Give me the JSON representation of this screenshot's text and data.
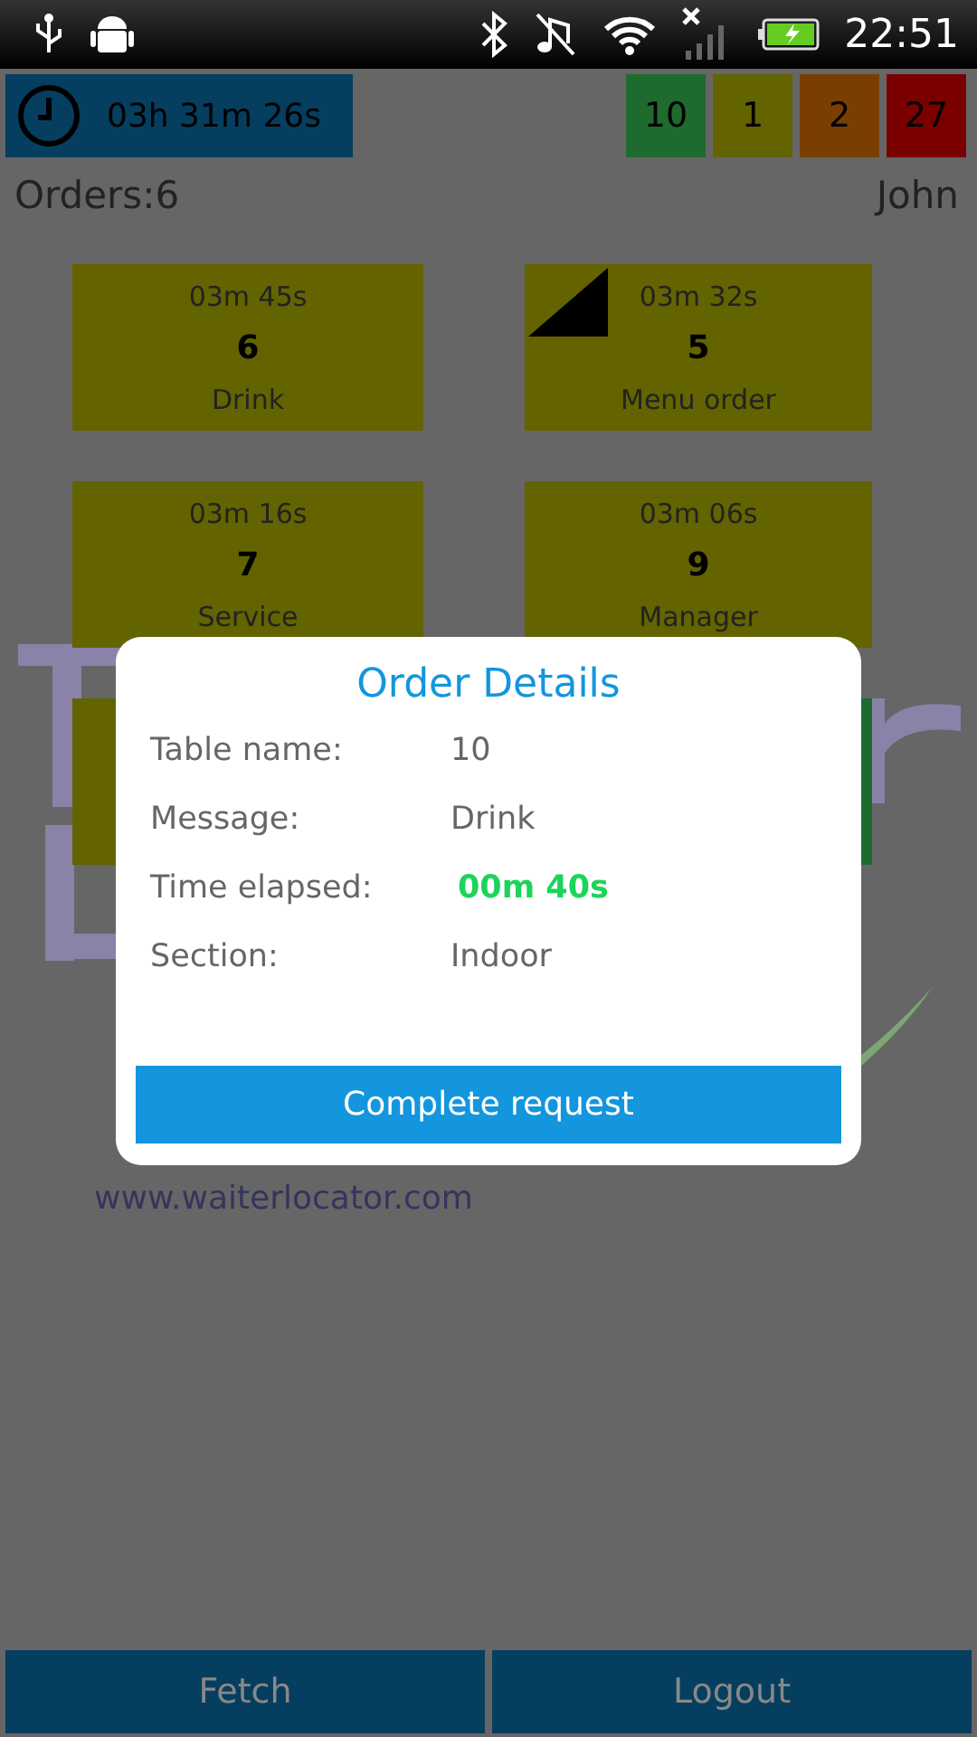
{
  "status_bar": {
    "time": "22:51"
  },
  "top_bar": {
    "timer": "03h 31m 26s",
    "counters": [
      {
        "value": "10",
        "color": "#1f6b2e"
      },
      {
        "value": "1",
        "color": "#636300"
      },
      {
        "value": "2",
        "color": "#7a3f00"
      },
      {
        "value": "27",
        "color": "#7a0000"
      }
    ]
  },
  "orders_label": "Orders:6",
  "user": "John",
  "tiles": [
    {
      "time": "03m 45s",
      "number": "6",
      "message": "Drink",
      "color": "#636300",
      "corner_marked": false
    },
    {
      "time": "03m 32s",
      "number": "5",
      "message": "Menu order",
      "color": "#636300",
      "corner_marked": true
    },
    {
      "time": "03m 16s",
      "number": "7",
      "message": "Service",
      "color": "#636300",
      "corner_marked": false
    },
    {
      "time": "03m 06s",
      "number": "9",
      "message": "Manager",
      "color": "#636300",
      "corner_marked": false
    },
    {
      "color": "#636300",
      "corner_marked": false
    },
    {
      "color": "#1f6b2e",
      "corner_marked": false
    }
  ],
  "website": "www.waiterlocator.com",
  "dialog": {
    "title": "Order Details",
    "fields": [
      {
        "label": "Table name:",
        "value": "10",
        "kind": "plain"
      },
      {
        "label": "Message:",
        "value": "Drink",
        "kind": "plain"
      },
      {
        "label": "Time elapsed:",
        "value": "00m 40s",
        "kind": "highlight"
      },
      {
        "label": "Section:",
        "value": "Indoor",
        "kind": "plain"
      }
    ],
    "button": "Complete request"
  },
  "footer": [
    "Fetch",
    "Logout"
  ]
}
